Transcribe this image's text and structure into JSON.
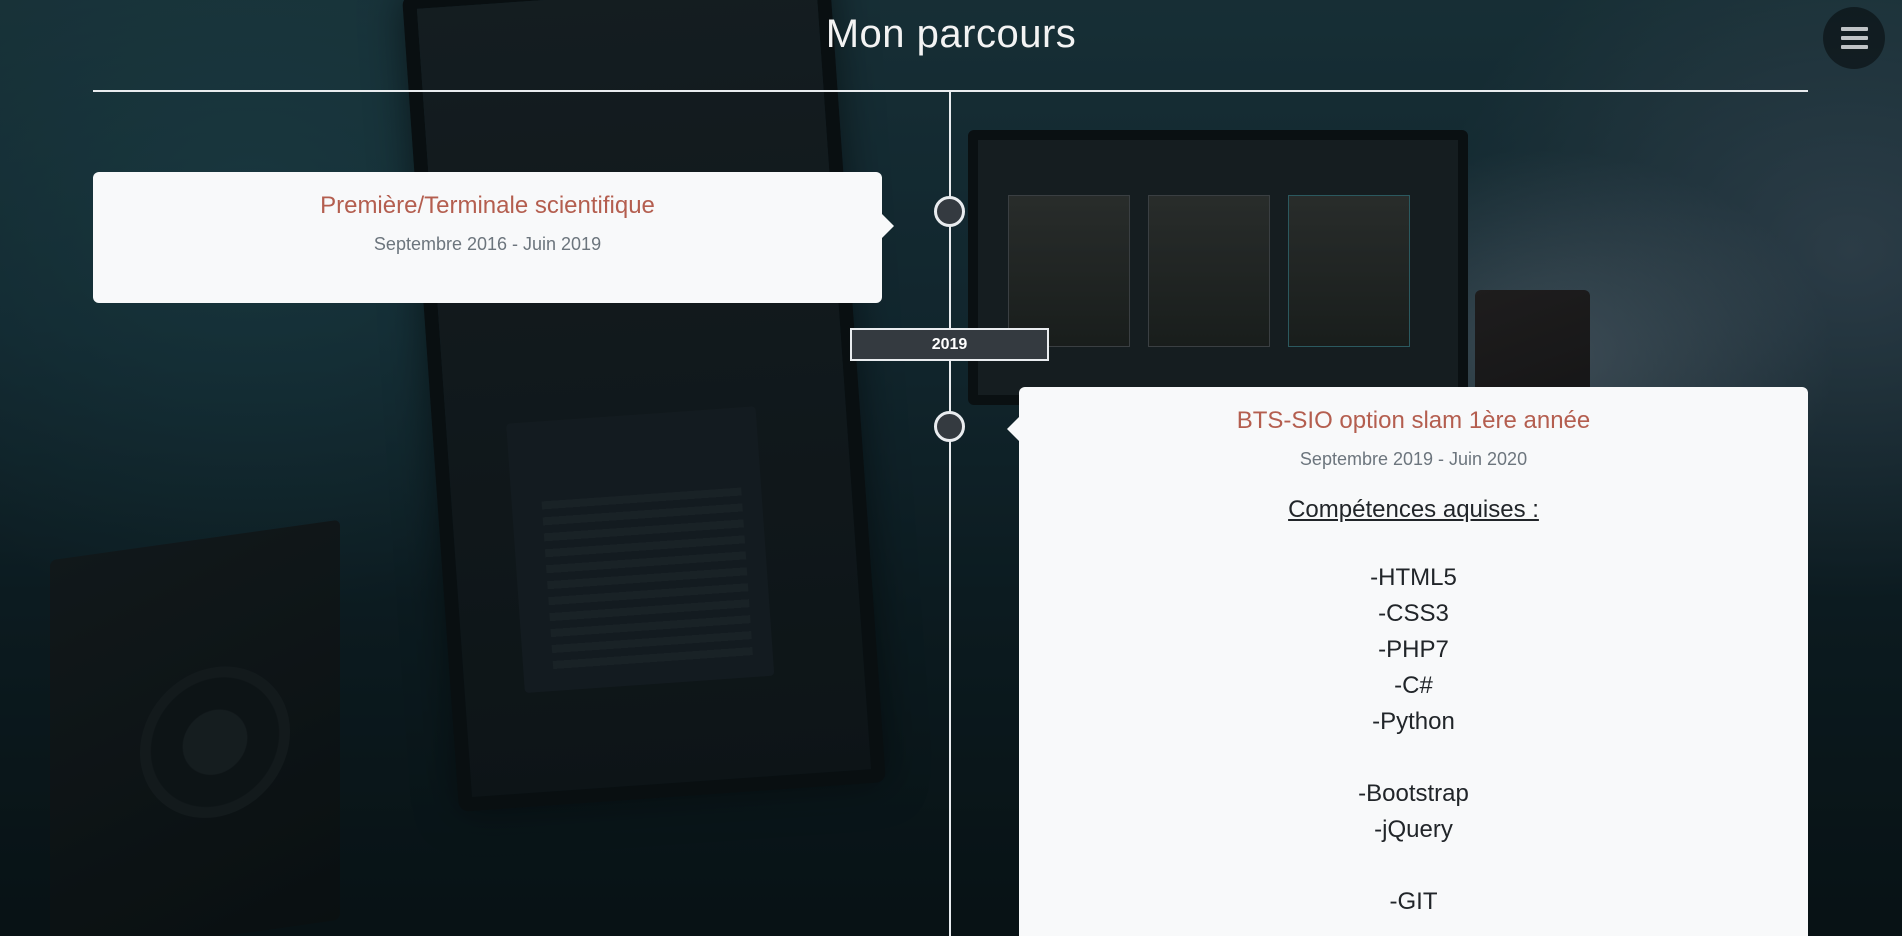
{
  "header": {
    "title": "Mon parcours",
    "menu_icon": "hamburger-menu-icon"
  },
  "timeline": {
    "entries": [
      {
        "title": "Première/Terminale scientifique",
        "dates": "Septembre 2016 - Juin 2019"
      },
      {
        "title": "BTS-SIO option slam 1ère année",
        "dates": "Septembre 2019 - Juin 2020",
        "skills_heading": "Compétences aquises :",
        "skills": [
          "-HTML5",
          "-CSS3",
          "-PHP7",
          "-C#",
          "-Python",
          "-Bootstrap",
          "-jQuery",
          "-GIT"
        ]
      }
    ],
    "year_badge": "2019"
  },
  "colors": {
    "accent_title": "#b45e4f",
    "card_background": "#f8f9fa",
    "timeline_line": "#e9ecef",
    "node_fill": "#343a40"
  }
}
